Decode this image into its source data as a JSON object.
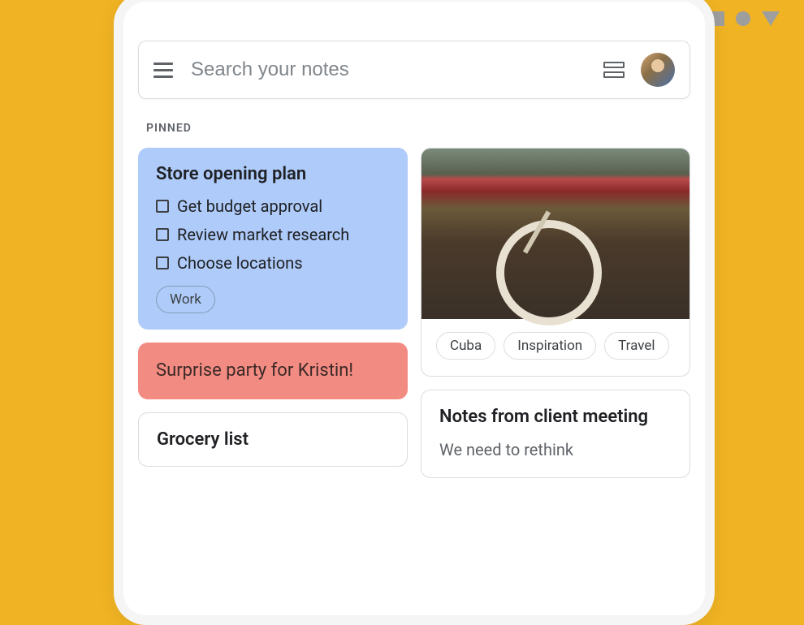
{
  "search": {
    "placeholder": "Search your notes"
  },
  "section_label": "PINNED",
  "notes": {
    "store_plan": {
      "title": "Store opening plan",
      "items": [
        "Get budget approval",
        "Review market research",
        "Choose locations"
      ],
      "tags": [
        "Work"
      ]
    },
    "surprise_party": {
      "text": "Surprise party for Kristin!"
    },
    "grocery": {
      "title": "Grocery list"
    },
    "cuba": {
      "tags": [
        "Cuba",
        "Inspiration",
        "Travel"
      ]
    },
    "client_meeting": {
      "title": "Notes from client meeting",
      "body": "We need to rethink"
    }
  }
}
